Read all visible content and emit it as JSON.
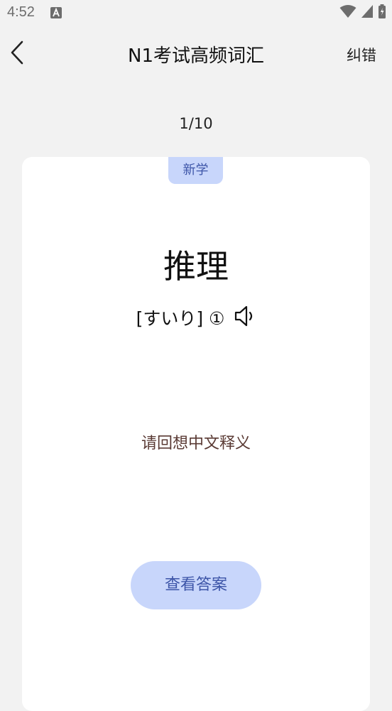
{
  "status_bar": {
    "time": "4:52",
    "notification_icon": "a-letter-icon",
    "icons": [
      "wifi-icon",
      "signal-icon",
      "battery-icon"
    ]
  },
  "header": {
    "back_icon": "chevron-left-icon",
    "title": "N1考试高频词汇",
    "correction_label": "纠错"
  },
  "progress": {
    "text": "1/10",
    "current": 1,
    "total": 10
  },
  "card": {
    "status_tag": "新学",
    "word": "推理",
    "reading": "[すいり] ①",
    "speaker_icon": "speaker-icon",
    "prompt": "请回想中文释义",
    "show_answer_label": "查看答案"
  },
  "colors": {
    "background": "#f2f2f2",
    "card": "#ffffff",
    "accent_fill": "#c8d6fb",
    "accent_text": "#3d55a8",
    "prompt_text": "#5a3a34"
  }
}
